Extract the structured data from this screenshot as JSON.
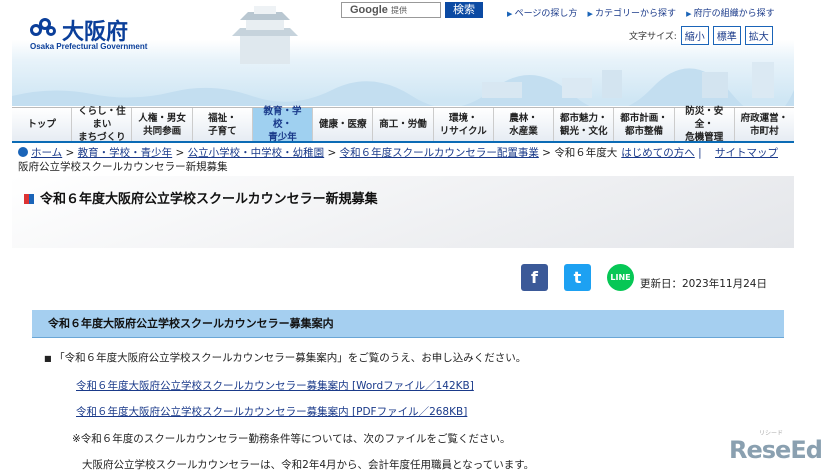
{
  "header": {
    "logo_name": "大阪府",
    "logo_sub": "Osaka Prefectural Government",
    "search_brand": "Google",
    "search_provided": "提供",
    "search_button": "検索",
    "top_links": [
      "ページの探し方",
      "カテゴリーから探す",
      "府庁の組織から探す"
    ],
    "font_size_label": "文字サイズ:",
    "font_size_buttons": [
      "縮小",
      "標準",
      "拡大"
    ]
  },
  "gnav": [
    {
      "l1": "トップ",
      "l2": ""
    },
    {
      "l1": "くらし・住まい",
      "l2": "まちづくり"
    },
    {
      "l1": "人権・男女",
      "l2": "共同参画"
    },
    {
      "l1": "福祉・",
      "l2": "子育て"
    },
    {
      "l1": "教育・学校・",
      "l2": "青少年"
    },
    {
      "l1": "健康・医療",
      "l2": ""
    },
    {
      "l1": "商工・労働",
      "l2": ""
    },
    {
      "l1": "環境・",
      "l2": "リサイクル"
    },
    {
      "l1": "農林・",
      "l2": "水産業"
    },
    {
      "l1": "都市魅力・",
      "l2": "観光・文化"
    },
    {
      "l1": "都市計画・",
      "l2": "都市整備"
    },
    {
      "l1": "防災・安全・",
      "l2": "危機管理"
    },
    {
      "l1": "府政運営・",
      "l2": "市町村"
    }
  ],
  "breadcrumb": {
    "items": [
      "ホーム",
      "教育・学校・青少年",
      "公立小学校・中学校・幼稚園",
      "令和６年度スクールカウンセラー配置事業"
    ],
    "current_part1": "令和６年度大",
    "current_part2": "阪府公立学校スクールカウンセラー新規募集",
    "right_links": [
      "はじめての方へ",
      "サイトマップ"
    ]
  },
  "page_title": "令和６年度大阪府公立学校スクールカウンセラー新規募集",
  "social": {
    "fb": "f",
    "tw": "t",
    "line": "LINE"
  },
  "updated": "更新日：2023年11月24日",
  "section_heading": "令和６年度大阪府公立学校スクールカウンセラー募集案内",
  "body": {
    "p1": "「令和６年度大阪府公立学校スクールカウンセラー募集案内」をご覧のうえ、お申し込みください。",
    "link1": "令和６年度大阪府公立学校スクールカウンセラー募集案内 [Wordファイル／142KB]",
    "link2": "令和６年度大阪府公立学校スクールカウンセラー募集案内 [PDFファイル／268KB]",
    "note": "※令和６年度のスクールカウンセラー勤務条件等については、次のファイルをご覧ください。",
    "p2": "大阪府公立学校スクールカウンセラーは、令和2年4月から、会計年度任用職員となっています。"
  },
  "watermark": {
    "main": "ReseEd",
    "sub": "リシード"
  }
}
